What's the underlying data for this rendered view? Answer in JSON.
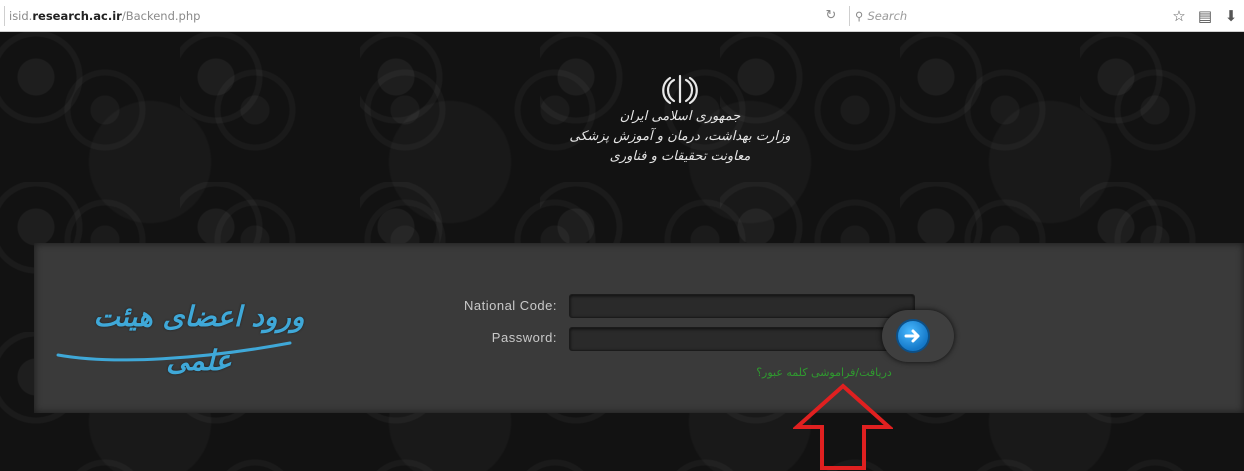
{
  "browser": {
    "url_prefix": "isid.",
    "url_host": "research.ac.ir",
    "url_path": "/Backend.php",
    "search_placeholder": "Search",
    "icons": [
      "reload-icon",
      "search-icon",
      "bookmark-star-icon",
      "reading-list-icon",
      "download-icon"
    ]
  },
  "header": {
    "ministry_lines": [
      "جمهوری اسلامی ایران",
      "وزارت بهداشت، درمان و آموزش پزشکی",
      "معاونت تحقیقات و فناوری"
    ]
  },
  "login": {
    "title": "ورود اعضای هیئت علمی",
    "national_code_label": "National Code:",
    "password_label": "Password:",
    "forgot_link": "دریافت/فراموشی کلمه عبور؟"
  },
  "colors": {
    "accent_blue": "#3fa8d8",
    "link_green": "#2f9a2f",
    "annotation_red": "#e02020",
    "band_gray": "#3a3a3a"
  }
}
